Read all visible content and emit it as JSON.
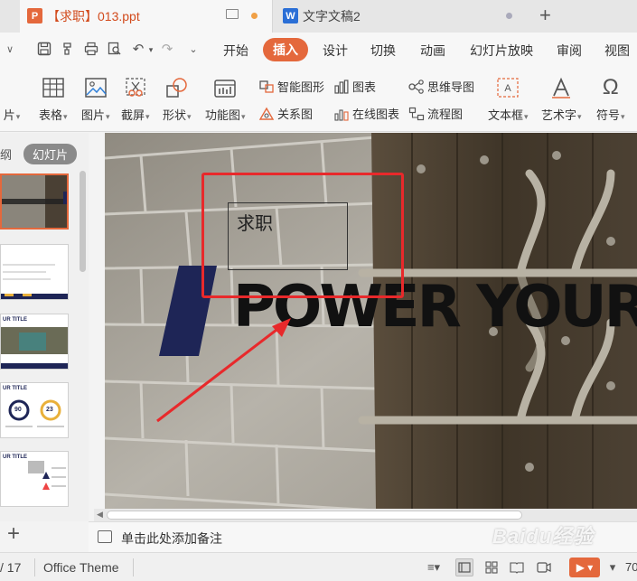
{
  "tabs": [
    {
      "title": "【求职】013.ppt",
      "app": "P",
      "active": true
    },
    {
      "title": "文字文稿2",
      "app": "W",
      "active": false
    }
  ],
  "menu": {
    "items": [
      "开始",
      "插入",
      "设计",
      "切换",
      "动画",
      "幻灯片放映",
      "审阅",
      "视图"
    ],
    "active": "插入"
  },
  "toolbar": {
    "partial_left": "片",
    "table": "表格",
    "picture": "图片",
    "screenshot": "截屏",
    "shape": "形状",
    "function_chart": "功能图",
    "smart_shape": "智能图形",
    "chart": "图表",
    "relation": "关系图",
    "online_chart": "在线图表",
    "mindmap": "思维导图",
    "flowchart": "流程图",
    "textbox": "文本框",
    "wordart": "艺术字",
    "symbol": "符号"
  },
  "panel": {
    "outline": "纲",
    "slides": "幻灯片",
    "thumb_title": "UR TITLE",
    "thumb_sub": "Add your title here",
    "kpi_a": "90",
    "kpi_b": "23"
  },
  "slide": {
    "textbox": "求职",
    "headline": "POWER YOUR"
  },
  "notes": {
    "placeholder": "单击此处添加备注"
  },
  "status": {
    "page": "/ 17",
    "theme": "Office Theme",
    "zoom": "70"
  },
  "watermark": "Baidu经验",
  "colors": {
    "accent": "#e4683c",
    "navy": "#1e2556",
    "annotation_red": "#e8292b"
  }
}
